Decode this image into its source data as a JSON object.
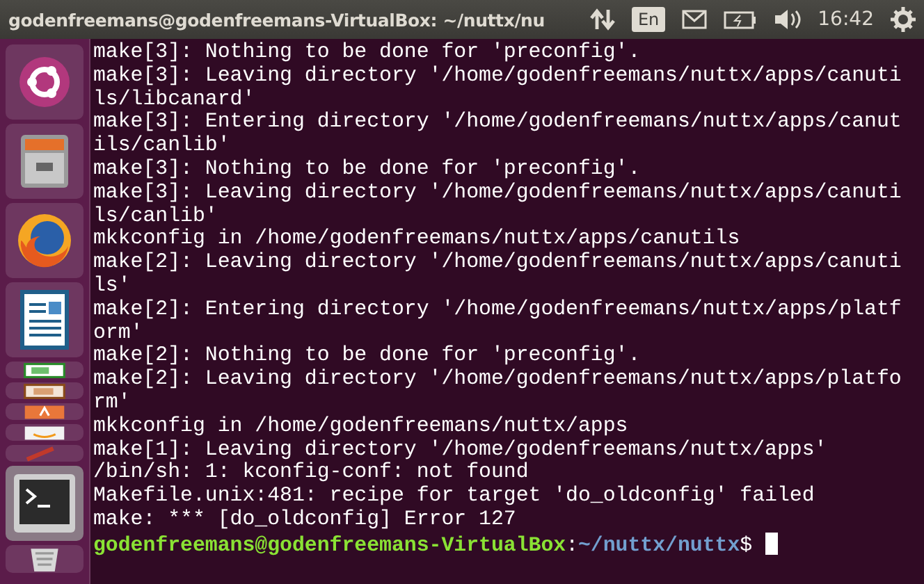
{
  "top_bar": {
    "title": "godenfreemans@godenfreemans-VirtualBox: ~/nuttx/nu",
    "keyboard": "En",
    "time": "16:42"
  },
  "launcher": {
    "items": [
      {
        "kind": "ubuntu",
        "active": false
      },
      {
        "kind": "files",
        "active": false
      },
      {
        "kind": "firefox",
        "active": false
      },
      {
        "kind": "writer",
        "active": false
      },
      {
        "kind": "calc",
        "active": false
      },
      {
        "kind": "impress",
        "active": false
      },
      {
        "kind": "software",
        "active": false
      },
      {
        "kind": "amazon",
        "active": false
      },
      {
        "kind": "settings",
        "active": false
      },
      {
        "kind": "terminal",
        "active": true
      },
      {
        "kind": "trash",
        "active": false
      }
    ]
  },
  "terminal": {
    "lines": [
      "make[3]: Nothing to be done for 'preconfig'.",
      "make[3]: Leaving directory '/home/godenfreemans/nuttx/apps/canuti",
      "ls/libcanard'",
      "make[3]: Entering directory '/home/godenfreemans/nuttx/apps/canut",
      "ils/canlib'",
      "make[3]: Nothing to be done for 'preconfig'.",
      "make[3]: Leaving directory '/home/godenfreemans/nuttx/apps/canuti",
      "ls/canlib'",
      "mkkconfig in /home/godenfreemans/nuttx/apps/canutils",
      "make[2]: Leaving directory '/home/godenfreemans/nuttx/apps/canuti",
      "ls'",
      "make[2]: Entering directory '/home/godenfreemans/nuttx/apps/platf",
      "orm'",
      "make[2]: Nothing to be done for 'preconfig'.",
      "make[2]: Leaving directory '/home/godenfreemans/nuttx/apps/platfo",
      "rm'",
      "mkkconfig in /home/godenfreemans/nuttx/apps",
      "make[1]: Leaving directory '/home/godenfreemans/nuttx/apps'",
      "/bin/sh: 1: kconfig-conf: not found",
      "Makefile.unix:481: recipe for target 'do_oldconfig' failed",
      "make: *** [do_oldconfig] Error 127"
    ],
    "prompt": {
      "user_host": "godenfreemans@godenfreemans-VirtualBox",
      "separator": ":",
      "path": "~/nuttx/nuttx",
      "symbol": "$"
    }
  }
}
